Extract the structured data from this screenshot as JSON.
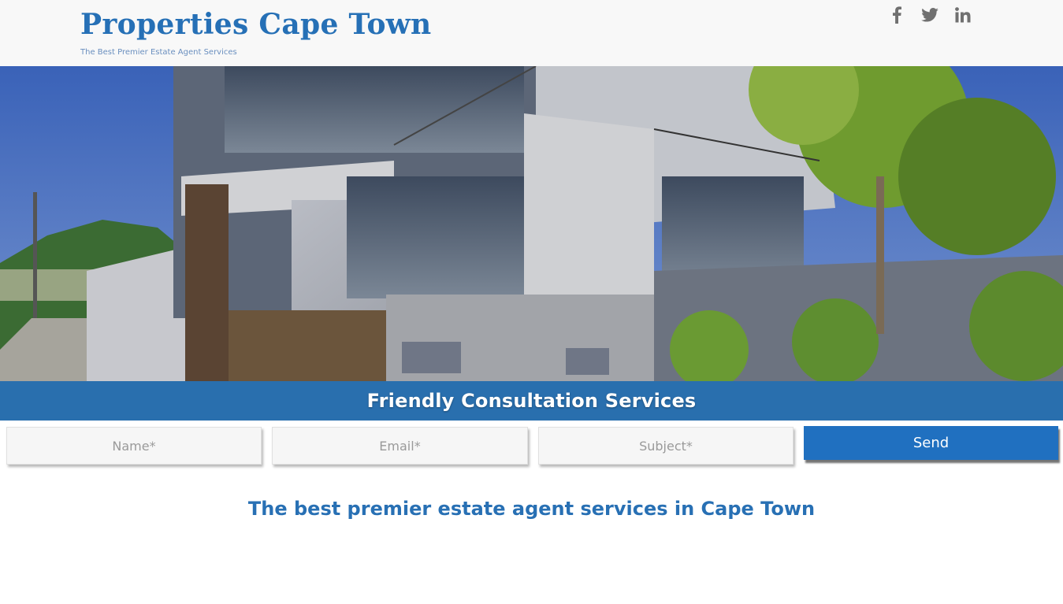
{
  "header": {
    "title": "Properties Cape Town",
    "tagline": "The Best Premier Estate Agent Services",
    "social": [
      {
        "icon": "facebook-icon",
        "color": "#707070"
      },
      {
        "icon": "twitter-icon",
        "color": "#707070"
      },
      {
        "icon": "linkedin-icon",
        "color": "#707070"
      }
    ]
  },
  "hero": {
    "banner_text": "Friendly Consultation Services",
    "banner_color": "#2470be"
  },
  "form": {
    "name_placeholder": "Name*",
    "email_placeholder": "Email*",
    "subject_placeholder": "Subject*",
    "send_label": "Send",
    "button_color": "#2070c0"
  },
  "main": {
    "headline": "The best premier estate agent services in Cape Town"
  },
  "colors": {
    "brand": "#2670b6",
    "header_bg": "#f8f8f8"
  }
}
